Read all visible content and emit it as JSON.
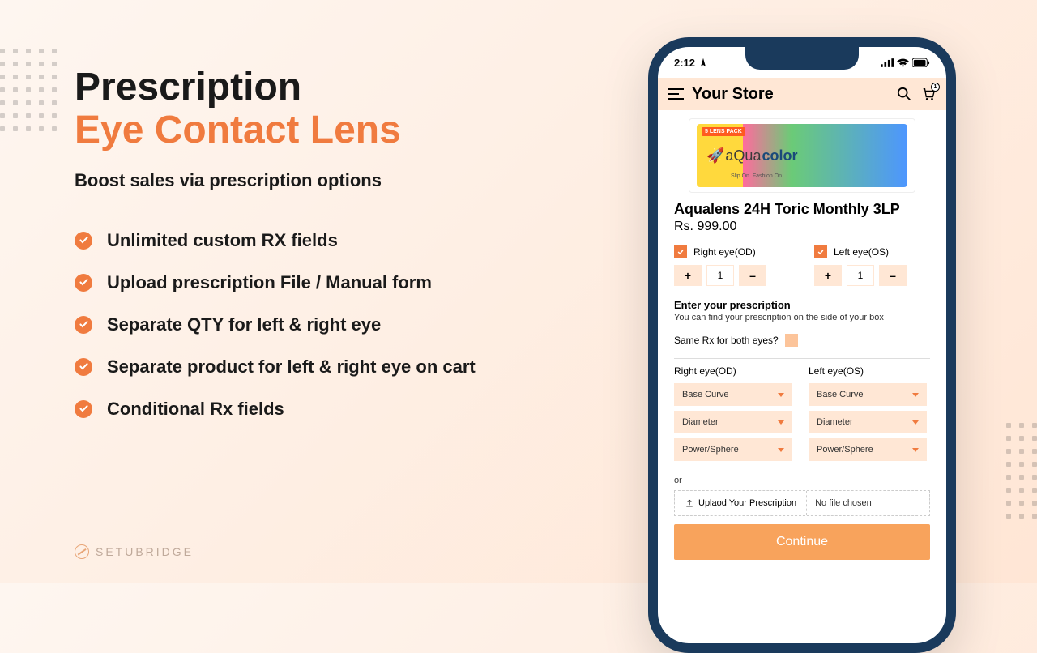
{
  "hero": {
    "line1": "Prescription",
    "line2": "Eye Contact Lens",
    "sub": "Boost sales via prescription options"
  },
  "features": [
    "Unlimited custom RX fields",
    "Upload prescription File / Manual form",
    "Separate QTY for left & right eye",
    "Separate product for left & right eye on cart",
    "Conditional Rx fields"
  ],
  "brand": "SETUBRIDGE",
  "status": {
    "time": "2:12"
  },
  "header": {
    "title": "Your Store",
    "cart_count": "1"
  },
  "product": {
    "box_tag": "5 LENS PACK",
    "brand1": "aQua",
    "brand2": "color",
    "tagline": "Slip On. Fashion On.",
    "name": "Aqualens 24H Toric Monthly 3LP",
    "price": "Rs. 999.00"
  },
  "eyes": {
    "right": {
      "label": "Right eye(OD)",
      "qty": "1"
    },
    "left": {
      "label": "Left eye(OS)",
      "qty": "1"
    }
  },
  "rx": {
    "title": "Enter your prescription",
    "note": "You can find your prescription on the side of your box",
    "same": "Same Rx for both eyes?",
    "right_h": "Right eye(OD)",
    "left_h": "Left eye(OS)",
    "fields": [
      "Base Curve",
      "Diameter",
      "Power/Sphere"
    ],
    "or": "or",
    "upload_btn": "Uplaod Your Prescription",
    "upload_status": "No file chosen",
    "continue": "Continue"
  }
}
